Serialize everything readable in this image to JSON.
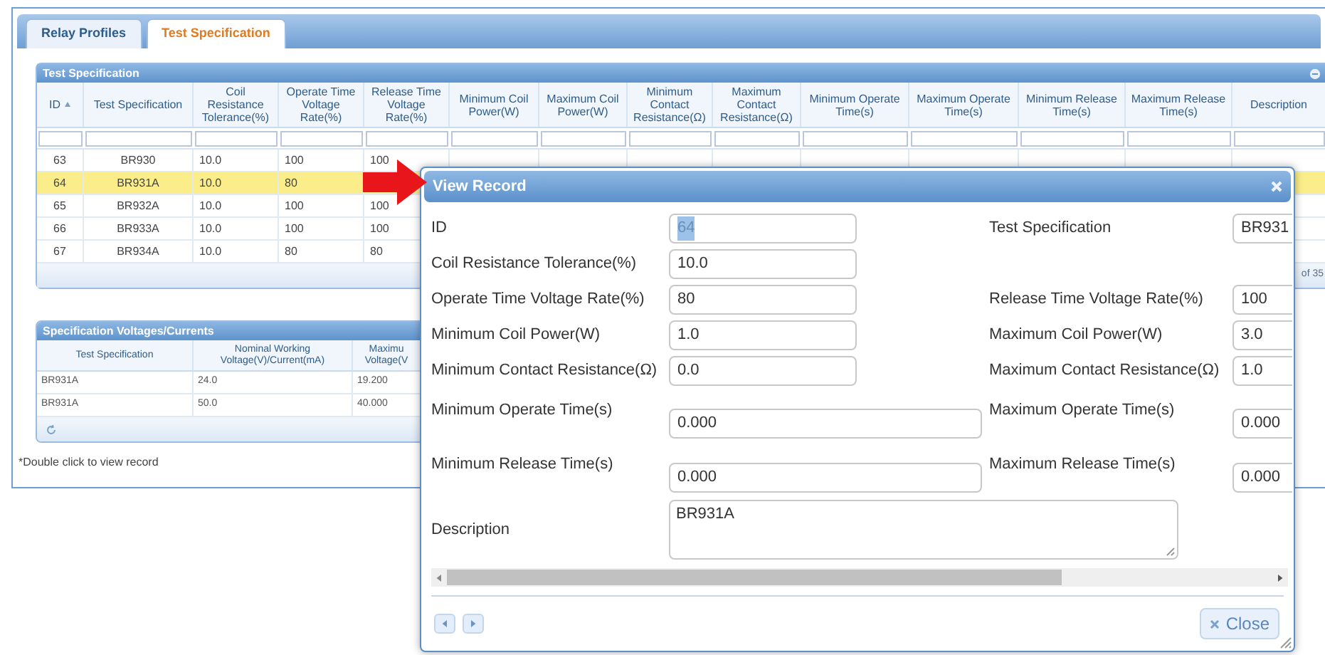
{
  "tabs": [
    {
      "label": "Relay Profiles",
      "selected": false
    },
    {
      "label": "Test Specification",
      "selected": true
    }
  ],
  "grid": {
    "title": "Test Specification",
    "columns": [
      {
        "label": "ID",
        "sorted": true
      },
      {
        "label": "Test Specification",
        "sorted": false
      },
      {
        "label": "Coil Resistance Tolerance(%)",
        "sorted": false
      },
      {
        "label": "Operate Time Voltage Rate(%)",
        "sorted": false
      },
      {
        "label": "Release Time Voltage Rate(%)",
        "sorted": false
      },
      {
        "label": "Minimum Coil Power(W)",
        "sorted": false
      },
      {
        "label": "Maximum Coil Power(W)",
        "sorted": false
      },
      {
        "label": "Minimum Contact Resistance(Ω)",
        "sorted": false
      },
      {
        "label": "Maximum Contact Resistance(Ω)",
        "sorted": false
      },
      {
        "label": "Minimum Operate Time(s)",
        "sorted": false
      },
      {
        "label": "Maximum Operate Time(s)",
        "sorted": false
      },
      {
        "label": "Minimum Release Time(s)",
        "sorted": false
      },
      {
        "label": "Maximum Release Time(s)",
        "sorted": false
      },
      {
        "label": "Description",
        "sorted": false
      }
    ],
    "rows": [
      {
        "cells": [
          "63",
          "BR930",
          "10.0",
          "100",
          "100"
        ],
        "selected": false
      },
      {
        "cells": [
          "64",
          "BR931A",
          "10.0",
          "80"
        ],
        "selected": true
      },
      {
        "cells": [
          "65",
          "BR932A",
          "10.0",
          "100",
          "100"
        ],
        "selected": false
      },
      {
        "cells": [
          "66",
          "BR933A",
          "10.0",
          "100",
          "100"
        ],
        "selected": false
      },
      {
        "cells": [
          "67",
          "BR934A",
          "10.0",
          "80",
          "80"
        ],
        "selected": false
      }
    ],
    "pager_text": "of 35"
  },
  "voltages": {
    "title": "Specification Voltages/Currents",
    "columns": [
      "Test Specification",
      "Nominal Working Voltage(V)/Current(mA)",
      "Maximu Voltage(V"
    ],
    "rows": [
      [
        "BR931A",
        "24.0",
        "19.200"
      ],
      [
        "BR931A",
        "50.0",
        "40.000"
      ]
    ]
  },
  "footnote": "*Double click to view record",
  "dialog": {
    "title": "View Record",
    "rows": [
      {
        "kind": "short",
        "left": {
          "label": "ID",
          "value": "64",
          "highlighted": true
        },
        "right": {
          "label": "Test Specification",
          "value": "BR931",
          "highlighted": false
        }
      },
      {
        "kind": "short",
        "left": {
          "label": "Coil Resistance Tolerance(%)",
          "value": "10.0",
          "highlighted": false
        }
      },
      {
        "kind": "short",
        "left": {
          "label": "Operate Time Voltage Rate(%)",
          "value": "80",
          "highlighted": false
        },
        "right": {
          "label": "Release Time Voltage Rate(%)",
          "value": "100",
          "highlighted": false
        }
      },
      {
        "kind": "short",
        "left": {
          "label": "Minimum Coil Power(W)",
          "value": "1.0",
          "highlighted": false
        },
        "right": {
          "label": "Maximum Coil Power(W)",
          "value": "3.0",
          "highlighted": false
        }
      },
      {
        "kind": "short",
        "left": {
          "label": "Minimum Contact Resistance(Ω)",
          "value": "0.0",
          "highlighted": false
        },
        "right": {
          "label": "Maximum Contact Resistance(Ω)",
          "value": "1.0",
          "highlighted": false
        }
      },
      {
        "kind": "wide",
        "left": {
          "label": "Minimum Operate Time(s)",
          "value": "0.000",
          "highlighted": false
        },
        "right": {
          "label": "Maximum Operate Time(s)",
          "value": "0.000",
          "highlighted": false
        }
      },
      {
        "kind": "wide",
        "left": {
          "label": "Minimum Release Time(s)",
          "value": "0.000",
          "highlighted": false
        },
        "right": {
          "label": "Maximum Release Time(s)",
          "value": "0.000",
          "highlighted": false
        }
      },
      {
        "kind": "textarea",
        "left": {
          "label": "Description",
          "value": "BR931A",
          "highlighted": false
        }
      }
    ],
    "close_label": "Close"
  }
}
